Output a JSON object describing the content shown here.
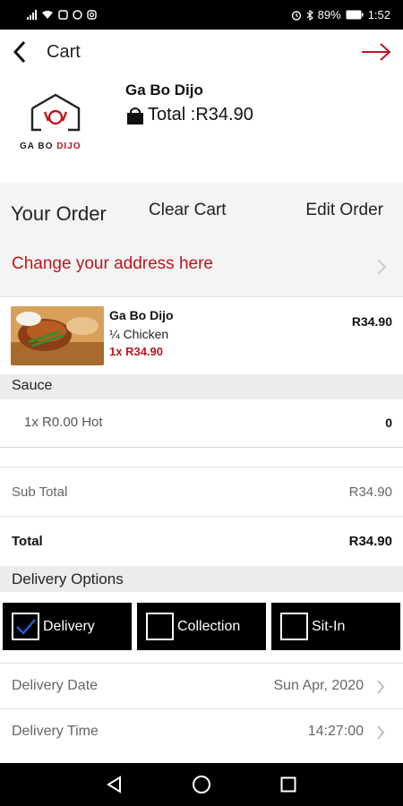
{
  "status_bar": {
    "right_text": "89%",
    "time": "1:52"
  },
  "header": {
    "title": "Cart",
    "back_icon": "chevron-left-icon",
    "next_icon": "arrow-right-icon"
  },
  "store": {
    "logo_text": "GA BO",
    "logo_text_accent": "DIJO",
    "name": "Ga Bo Dijo",
    "total_label": "Total :R34.90",
    "total_icon": "shopping-bag-icon"
  },
  "order_header": {
    "your_order": "Your Order",
    "clear_cart": "Clear Cart",
    "edit_order": "Edit Order",
    "change_address": "Change your address here"
  },
  "cart_item": {
    "store": "Ga Bo Dijo",
    "name": "¼ Chicken",
    "qty_price": "1x R34.90",
    "price": "R34.90"
  },
  "sauce": {
    "heading": "Sauce",
    "item": "1x R0.00 Hot",
    "qty": "0"
  },
  "summary": {
    "sub_total_label": "Sub Total",
    "sub_total_value": "R34.90",
    "total_label": "Total",
    "total_value": "R34.90"
  },
  "delivery": {
    "heading": "Delivery Options",
    "options": [
      {
        "label": "Delivery",
        "checked": true
      },
      {
        "label": "Collection",
        "checked": false
      },
      {
        "label": "Sit-In",
        "checked": false
      }
    ],
    "date_label": "Delivery Date",
    "date_value": "Sun Apr, 2020",
    "time_label": "Delivery Time",
    "time_value": "14:27:00"
  },
  "colors": {
    "accent_red": "#c0141c",
    "check_blue": "#1e63d6",
    "option_bg": "#000000"
  }
}
